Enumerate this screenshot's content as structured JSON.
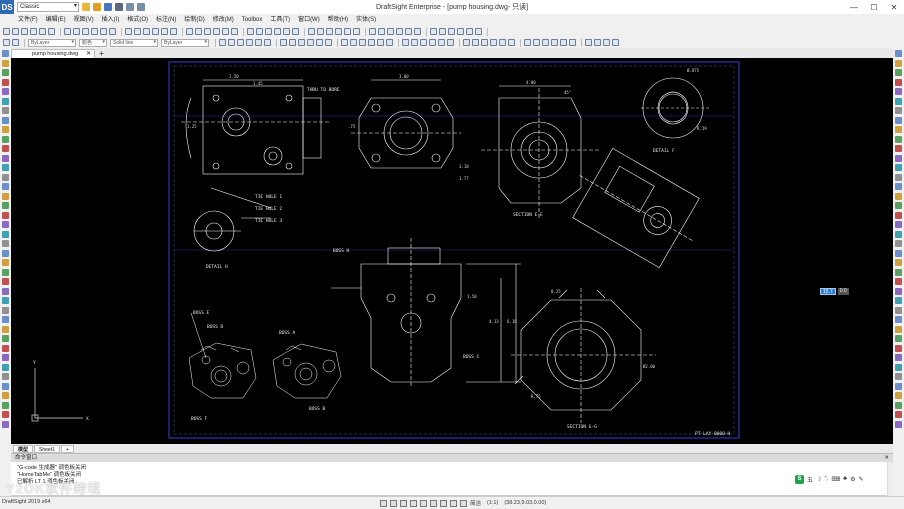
{
  "app": {
    "logo": "DS",
    "window_title": "DraftSight Enterprise - [pump housing.dwg- 只读]",
    "workspace": "Classic",
    "minimize": "—",
    "maximize": "☐",
    "close": "✕"
  },
  "menu": [
    "文件(F)",
    "编辑(E)",
    "视图(V)",
    "插入(I)",
    "格式(O)",
    "标注(N)",
    "绘制(D)",
    "修改(M)",
    "Toolbox",
    "工具(T)",
    "窗口(W)",
    "帮助(H)",
    "实体(S)"
  ],
  "toolbar": {
    "layer_combo": "ByLayer",
    "color_combo": "颜色",
    "linetype_combo": "Solid line",
    "lineweight_combo": "ByLayer"
  },
  "document_tab": {
    "label": "pump housing.dwg",
    "close": "✕",
    "add": "+"
  },
  "drawing": {
    "labels": {
      "detail_h": "DETAIL H",
      "detail_f": "DETAIL F",
      "section_ee": "SECTION E-E",
      "section_gg": "SECTION G-G",
      "boss_h": "BOSS H",
      "boss_d": "BOSS D",
      "boss_e": "BOSS E",
      "boss_a": "BOSS A",
      "boss_b": "BOSS B",
      "boss_c": "BOSS C",
      "boss_f": "BOSS F",
      "thru_hole": "THRU TO BORE",
      "tie_hole_1": "TIE HOLE 1",
      "tie_hole_2": "TIE HOLE 2",
      "tie_hole_3": "TIE HOLE 3",
      "title_block": "PT-LAY-0000-H"
    },
    "dims": [
      "2.50",
      "1.45",
      "3.00",
      "4.00",
      "1.25",
      ".75",
      "Ø.875",
      "3.18",
      "1.77",
      "45°",
      "R.19",
      "0.25",
      "1.50",
      "Ø2.00",
      "R.75",
      "4.13",
      "6.18"
    ],
    "axis_x": "X",
    "axis_y": "Y"
  },
  "coord_popup": {
    "value1": "15.7",
    "value2": "0.0"
  },
  "sheet_tabs": [
    "模型",
    "Sheet1",
    "+"
  ],
  "command_window": {
    "title": "命令窗口",
    "close": "✕",
    "lines": [
      "\"G-code 生成器\" 调色板关闭",
      "\"HomeTabMe\" 调色板关闭",
      "已解析 LT 1 调色板关闭"
    ]
  },
  "ime": {
    "logo": "S",
    "items": [
      "五",
      "☽",
      "°,",
      "⌨",
      "♣",
      "⚙",
      "✎"
    ]
  },
  "status": {
    "version": "DraftSight 2019 x64",
    "annotation": "简洁",
    "scale": "(1:1)",
    "coords": "(38.23,9.03,0.00)"
  },
  "watermark": "Y2OK软件跨境",
  "colors": {
    "canvas_bg": "#000000",
    "drawing_lines": "#ffffff",
    "frame_border": "#3a3ad0",
    "accent": "#2f7fcf",
    "ime_green": "#1fa34a"
  }
}
